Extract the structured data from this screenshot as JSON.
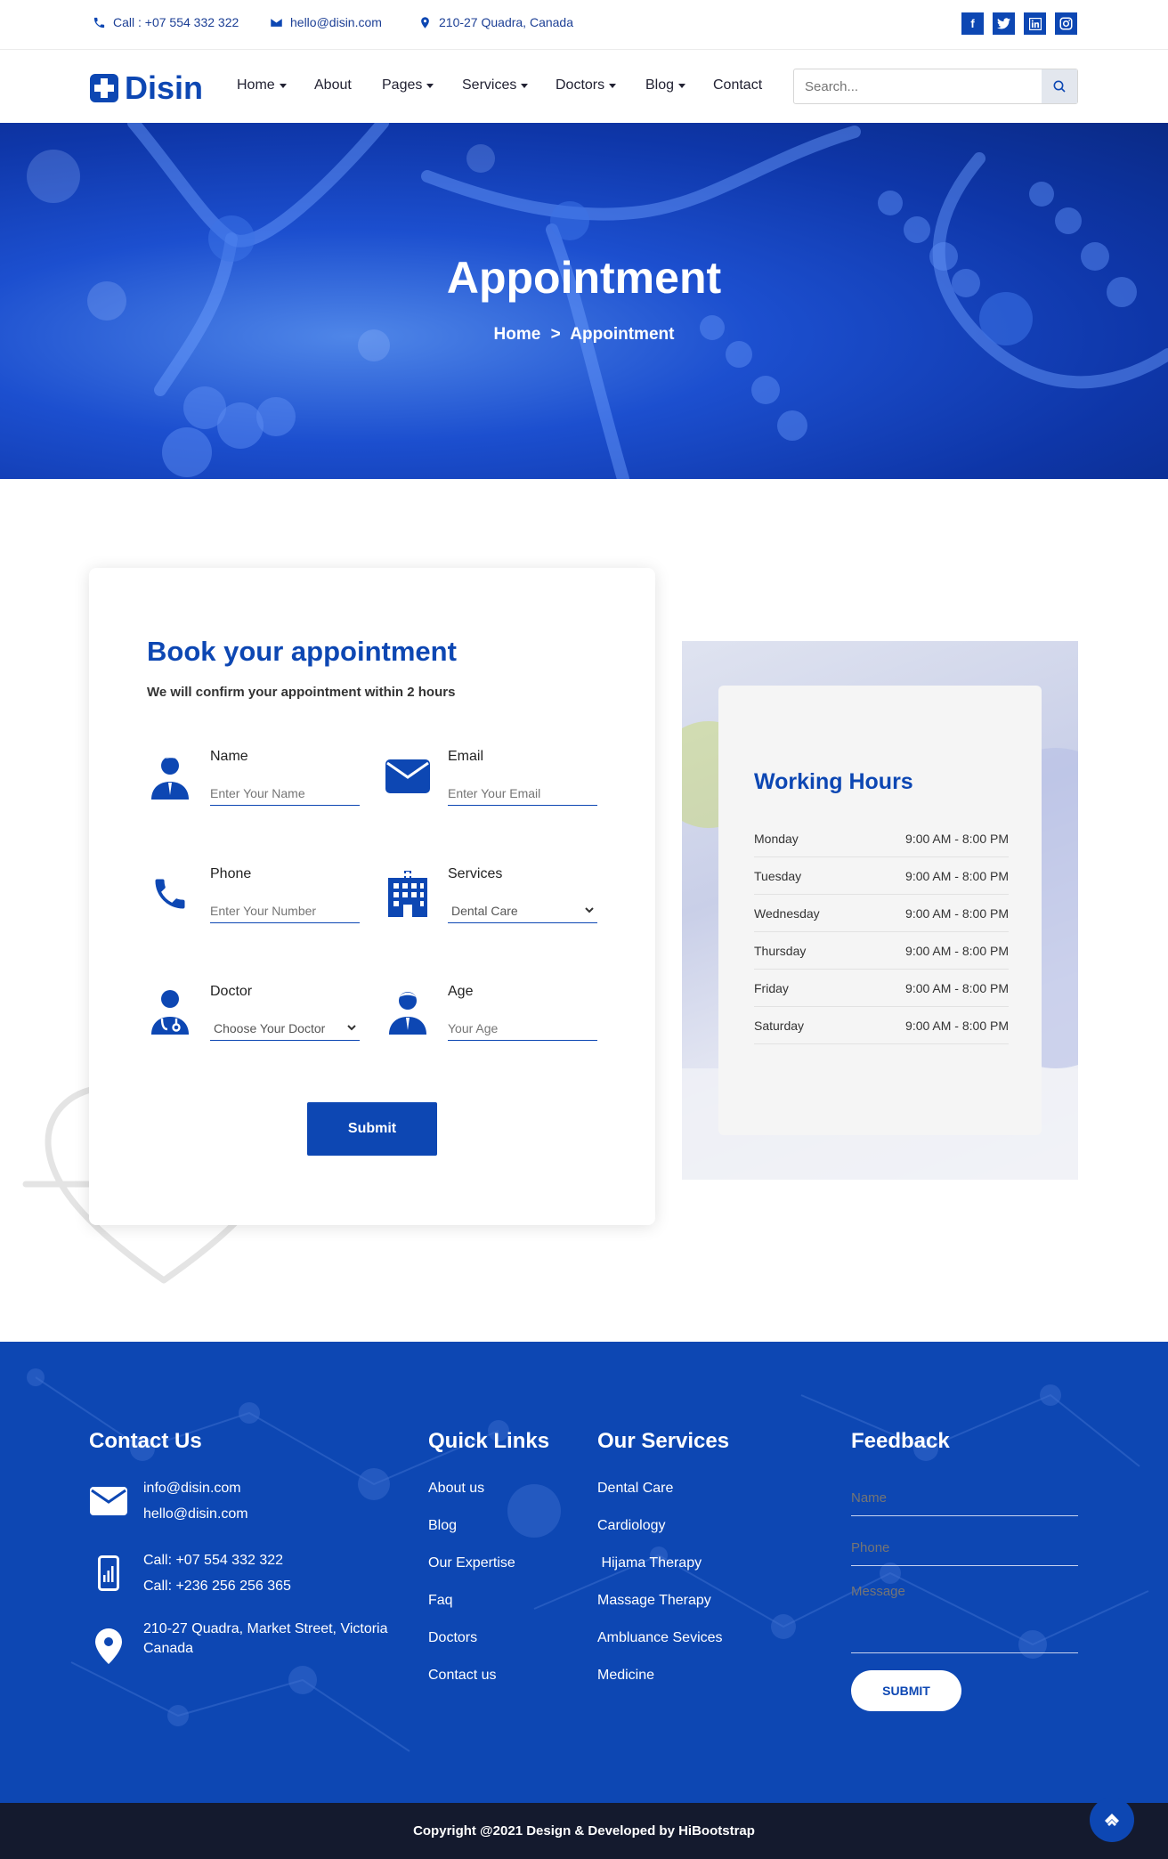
{
  "topbar": {
    "phone": "Call : +07 554 332 322",
    "email": "hello@disin.com",
    "address": "210-27 Quadra, Canada",
    "social": [
      "f",
      "t",
      "in",
      "ig"
    ]
  },
  "nav": {
    "logo": "Disin",
    "items": [
      {
        "label": "Home",
        "dropdown": true
      },
      {
        "label": "About",
        "dropdown": false
      },
      {
        "label": "Pages",
        "dropdown": true
      },
      {
        "label": "Services",
        "dropdown": true
      },
      {
        "label": "Doctors",
        "dropdown": true
      },
      {
        "label": "Blog",
        "dropdown": true
      },
      {
        "label": "Contact",
        "dropdown": false
      }
    ],
    "search_placeholder": "Search..."
  },
  "hero": {
    "title": "Appointment",
    "breadcrumb_home": "Home",
    "breadcrumb_sep": ">",
    "breadcrumb_current": "Appointment"
  },
  "form": {
    "title": "Book your appointment",
    "subtitle": "We will confirm your appointment within 2 hours",
    "name_label": "Name",
    "name_placeholder": "Enter Your Name",
    "email_label": "Email",
    "email_placeholder": "Enter Your Email",
    "phone_label": "Phone",
    "phone_placeholder": "Enter Your Number",
    "services_label": "Services",
    "services_value": "Dental Care",
    "doctor_label": "Doctor",
    "doctor_value": "Choose Your Doctor",
    "age_label": "Age",
    "age_placeholder": "Your Age",
    "submit": "Submit"
  },
  "hours": {
    "title": "Working Hours",
    "rows": [
      {
        "day": "Monday",
        "time": "9:00 AM - 8:00 PM"
      },
      {
        "day": "Tuesday",
        "time": "9:00 AM - 8:00 PM"
      },
      {
        "day": "Wednesday",
        "time": "9:00 AM - 8:00 PM"
      },
      {
        "day": "Thursday",
        "time": "9:00 AM - 8:00 PM"
      },
      {
        "day": "Friday",
        "time": "9:00 AM - 8:00 PM"
      },
      {
        "day": "Saturday",
        "time": "9:00 AM - 8:00 PM"
      }
    ]
  },
  "footer": {
    "contact_title": "Contact Us",
    "email1": "info@disin.com",
    "email2": "hello@disin.com",
    "phone1": "Call: +07 554 332 322",
    "phone2": "Call: +236 256 256 365",
    "address_line1": "210-27 Quadra, Market Street, Victoria",
    "address_line2": "Canada",
    "links_title": "Quick Links",
    "links": [
      "About us",
      "Blog",
      "Our Expertise",
      "Faq",
      "Doctors",
      "Contact us"
    ],
    "services_title": "Our Services",
    "services": [
      "Dental Care",
      "Cardiology",
      " Hijama Therapy",
      "Massage Therapy",
      "Ambluance Sevices",
      "Medicine"
    ],
    "feedback_title": "Feedback",
    "fb_name": "Name",
    "fb_phone": "Phone",
    "fb_message": "Message",
    "fb_submit": "SUBMIT",
    "copyright": "Copyright @2021 Design & Developed by HiBootstrap"
  },
  "colors": {
    "primary": "#0d47b3",
    "dark": "#141a2e"
  }
}
